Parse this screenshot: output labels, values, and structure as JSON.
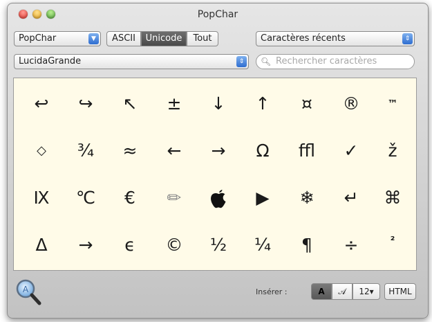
{
  "window": {
    "title": "PopChar"
  },
  "toolbar": {
    "app_popup": "PopChar",
    "segments": [
      "ASCII",
      "Unicode",
      "Tout"
    ],
    "selected_segment": "Unicode",
    "recent_popup": "Caractères récents",
    "font_popup": "LucidaGrande",
    "search_placeholder": "Rechercher caractères"
  },
  "characters": [
    [
      "↩",
      "↪",
      "↖",
      "±",
      "↓",
      "↑",
      "¤",
      "®",
      "™"
    ],
    [
      "◇",
      "¾",
      "≈",
      "←",
      "→",
      "Ω",
      "ﬄ",
      "✓",
      "ž"
    ],
    [
      "Ⅸ",
      "℃",
      "€",
      "✏",
      "",
      "▶",
      "❄",
      "↵",
      "⌘"
    ],
    [
      "Δ",
      "→",
      "ϵ",
      "©",
      "½",
      "¼",
      "¶",
      "÷",
      "²"
    ]
  ],
  "bottom": {
    "insert_label": "Insérer :",
    "insert_buttons": [
      "A",
      "𝒜",
      "12▾",
      "HTML"
    ],
    "selected_insert": "A"
  },
  "icons": {
    "zoom": "magnifier-icon",
    "popup_arrow": "popup-arrow-icon",
    "apple": "apple-logo-icon"
  }
}
